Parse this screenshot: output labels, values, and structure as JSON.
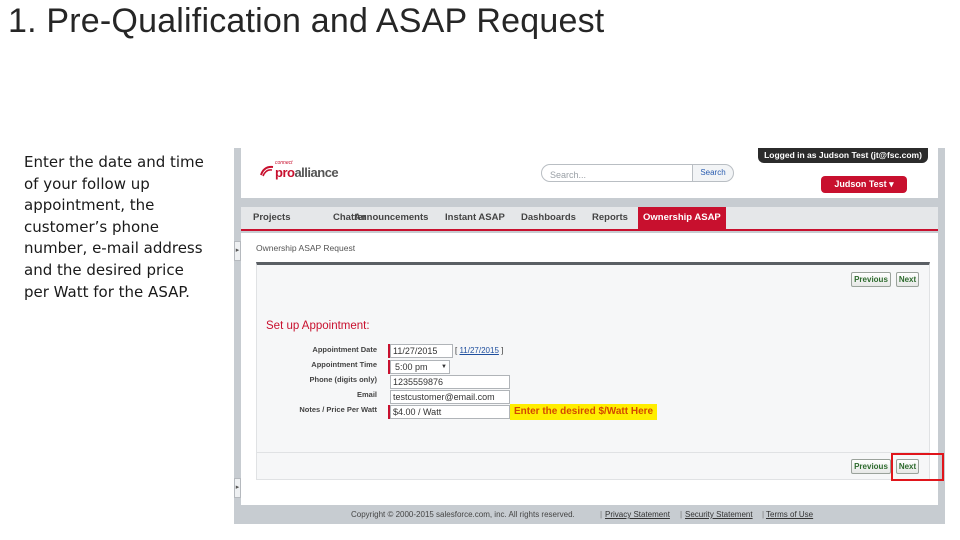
{
  "slide": {
    "title": "1. Pre-Qualification and ASAP Request",
    "description_lines": [
      "Enter the date and time",
      "of your follow up",
      "appointment, the",
      "customer’s phone",
      "number, e-mail address",
      "and the desired price",
      "per Watt for the ASAP."
    ]
  },
  "header": {
    "logo_small": "connect",
    "logo_accent": "pro",
    "logo_text": "alliance",
    "search_placeholder": "Search...",
    "search_button": "Search",
    "logged_in": "Logged in as Judson Test (jt@fsc.com)",
    "user_menu": "Judson Test ▾"
  },
  "tabs": [
    {
      "label": "Projects",
      "active": false
    },
    {
      "label": "Chatter",
      "active": false
    },
    {
      "label": "Announcements",
      "active": false
    },
    {
      "label": "Instant ASAP",
      "active": false
    },
    {
      "label": "Dashboards",
      "active": false
    },
    {
      "label": "Reports",
      "active": false
    },
    {
      "label": "Ownership ASAP",
      "active": true
    }
  ],
  "page": {
    "breadcrumb": "Ownership ASAP Request",
    "buttons": {
      "previous": "Previous",
      "next": "Next"
    },
    "section_title": "Set up Appointment:",
    "fields": {
      "appointment_date": {
        "label": "Appointment Date",
        "value": "11/27/2015",
        "link_open": "[ ",
        "link": "11/27/2015",
        "link_close": " ]"
      },
      "appointment_time": {
        "label": "Appointment Time",
        "value": "5:00 pm",
        "arrow": "▼"
      },
      "phone": {
        "label": "Phone (digits only)",
        "value": "1235559876"
      },
      "email": {
        "label": "Email",
        "value": "testcustomer@email.com"
      },
      "notes": {
        "label": "Notes / Price Per Watt",
        "value": "$4.00 / Watt"
      }
    },
    "callout": "Enter the desired $/Watt Here"
  },
  "footer": {
    "copyright": "Copyright © 2000-2015 salesforce.com, inc. All rights reserved.",
    "separator": "|",
    "links": [
      "Privacy Statement",
      "Security Statement",
      "Terms of Use"
    ]
  },
  "colors": {
    "brand_red": "#c8102e",
    "callout_yellow": "#ffee00",
    "callout_text": "#d24a00",
    "highlight_box": "#e0151b"
  }
}
